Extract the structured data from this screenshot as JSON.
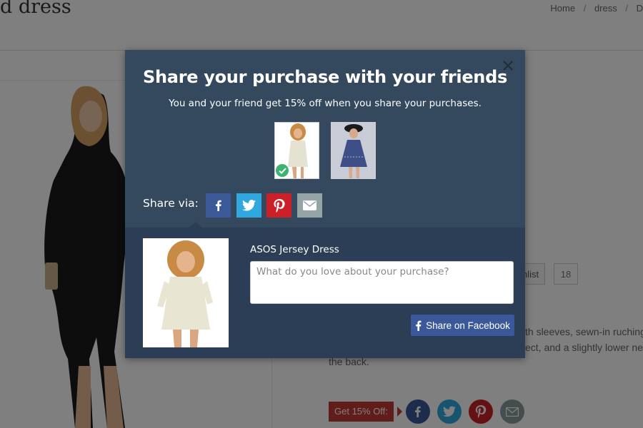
{
  "background": {
    "page_title": "d dress",
    "breadcrumb": [
      "Home",
      "dress",
      "D"
    ],
    "breadcrumb_sep": "/",
    "wishlist_label": "hlist",
    "wishlist_count": "18",
    "description_lines": [
      "th sleeves, sewn-in ruching",
      "ect, and a slightly lower ne",
      "the back."
    ],
    "get_off_label": "Get 15% Off:"
  },
  "modal": {
    "title": "Share your purchase with your friends",
    "subtitle": "You and your friend get 15% off when you share your purchases.",
    "share_via_label": "Share via:",
    "product_name": "ASOS Jersey Dress",
    "comment_placeholder": "What do you love about your purchase?",
    "comment_value": "",
    "facebook_button_label": "Share on Facebook",
    "selected_product_index": 0
  },
  "icons": {
    "close": "close-icon",
    "check": "check-icon",
    "facebook": "facebook-icon",
    "twitter": "twitter-icon",
    "pinterest": "pinterest-icon",
    "email": "email-icon"
  },
  "colors": {
    "modal_bg": "#34495e",
    "modal_bottom_bg": "#2c3e55",
    "facebook": "#3b5998",
    "twitter": "#2fa8e0",
    "pinterest": "#cb2027",
    "email": "#95a5a6",
    "check": "#3cb371",
    "get_off": "#c23b33"
  }
}
